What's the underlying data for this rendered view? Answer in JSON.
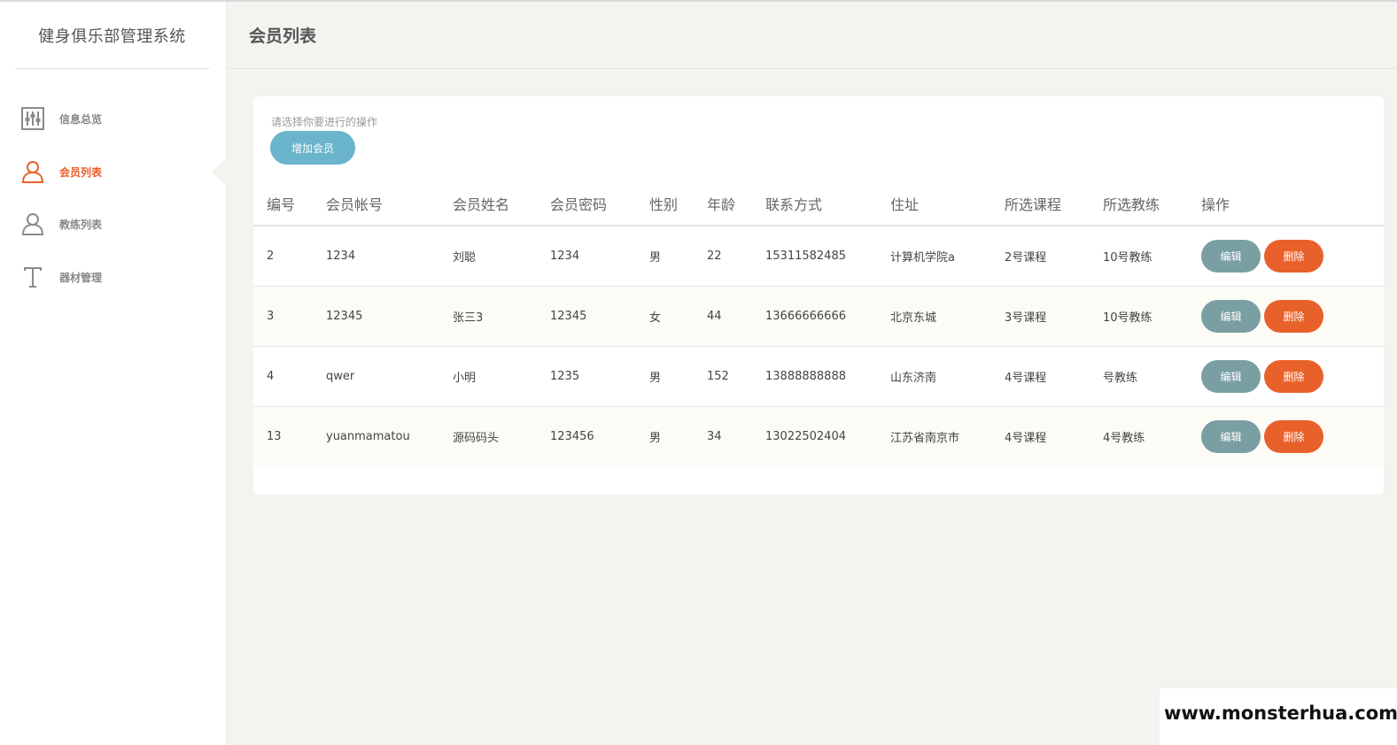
{
  "brand": "健身俱乐部管理系统",
  "sidebar": {
    "items": [
      {
        "label": "信息总览",
        "icon": "sliders-icon",
        "active": false
      },
      {
        "label": "会员列表",
        "icon": "user-icon",
        "active": true
      },
      {
        "label": "教练列表",
        "icon": "user-outline-icon",
        "active": false
      },
      {
        "label": "器材管理",
        "icon": "text-t-icon",
        "active": false
      }
    ]
  },
  "header": {
    "title": "会员列表"
  },
  "main": {
    "prompt": "请选择你要进行的操作",
    "add_button": "增加会员",
    "table": {
      "columns": [
        "编号",
        "会员帐号",
        "会员姓名",
        "会员密码",
        "性别",
        "年龄",
        "联系方式",
        "住址",
        "所选课程",
        "所选教练",
        "操作"
      ],
      "rows": [
        [
          "2",
          "1234",
          "刘聪",
          "1234",
          "男",
          "22",
          "15311582485",
          "计算机学院a",
          "2号课程",
          "10号教练"
        ],
        [
          "3",
          "12345",
          "张三3",
          "12345",
          "女",
          "44",
          "13666666666",
          "北京东城",
          "3号课程",
          "10号教练"
        ],
        [
          "4",
          "qwer",
          "小明",
          "1235",
          "男",
          "152",
          "13888888888",
          "山东济南",
          "4号课程",
          "号教练"
        ],
        [
          "13",
          "yuanmamatou",
          "源码码头",
          "123456",
          "男",
          "34",
          "13022502404",
          "江苏省南京市",
          "4号课程",
          "4号教练"
        ]
      ],
      "edit_label": "编辑",
      "delete_label": "删除"
    }
  },
  "watermark": "www.monsterhua.com",
  "colors": {
    "accent": "#e8602c",
    "add_button": "#6ab4cc",
    "edit_button": "#7a9fa2",
    "delete_button": "#e9612a",
    "background": "#f4f3f0"
  }
}
